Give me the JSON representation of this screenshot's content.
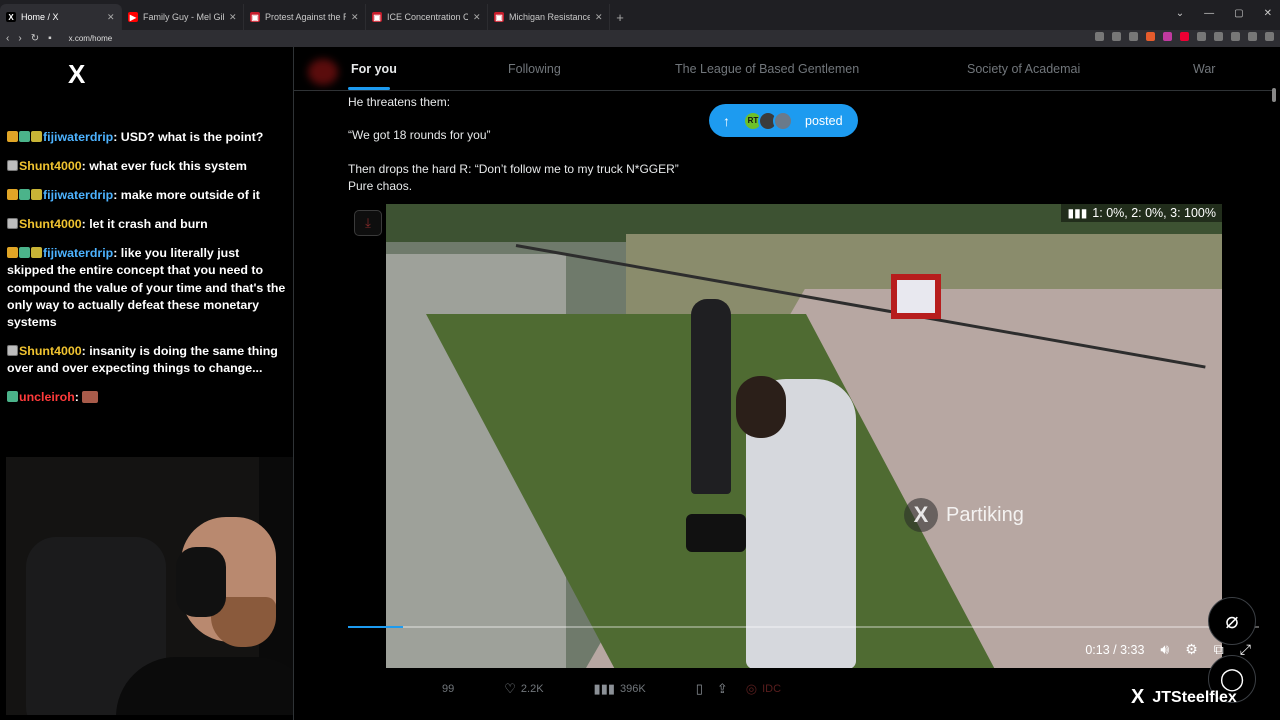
{
  "browser": {
    "tabs": [
      {
        "title": "Home / X",
        "fav": "X",
        "fav_color": "#000000",
        "active": true
      },
      {
        "title": "Family Guy - Mel Gibson Apologizes",
        "fav": "▶",
        "fav_color": "#ff0000",
        "active": false
      },
      {
        "title": "Protest Against the Regime - Royal Oak",
        "fav": "▣",
        "fav_color": "#c61c2b",
        "active": false
      },
      {
        "title": "ICE Concentration Camp Warehouse",
        "fav": "▣",
        "fav_color": "#c61c2b",
        "active": false
      },
      {
        "title": "Michigan Resistance & Activism Events",
        "fav": "▣",
        "fav_color": "#c61c2b",
        "active": false
      }
    ],
    "new_tab": "+",
    "url": "x.com/home"
  },
  "chat": {
    "logo": "X",
    "messages": [
      {
        "badges": [
          "crown",
          "green",
          "gold"
        ],
        "user": "fijiwaterdrip",
        "user_color": "blue",
        "text": ": USD? what is the point?"
      },
      {
        "badges": [
          "grey"
        ],
        "user": "Shunt4000",
        "user_color": "gold",
        "text": ": what ever fuck this system"
      },
      {
        "badges": [
          "crown",
          "green",
          "gold"
        ],
        "user": "fijiwaterdrip",
        "user_color": "blue",
        "text": ": make more outside of it"
      },
      {
        "badges": [
          "grey"
        ],
        "user": "Shunt4000",
        "user_color": "gold",
        "text": ": let it crash and burn"
      },
      {
        "badges": [
          "crown",
          "green",
          "gold"
        ],
        "user": "fijiwaterdrip",
        "user_color": "blue",
        "text": ": like you literally just skipped the entire concept that you need to compound the value of your time and that's the only way to actually defeat these monetary systems"
      },
      {
        "badges": [
          "grey"
        ],
        "user": "Shunt4000",
        "user_color": "gold",
        "text": ": insanity is doing the same thing over and over expecting things to change..."
      },
      {
        "badges": [
          "green"
        ],
        "user": "uncleiroh",
        "user_color": "red",
        "text": ": ",
        "emote": true
      }
    ]
  },
  "feed": {
    "tabs": [
      {
        "label": "For you",
        "active": true
      },
      {
        "label": "Following",
        "active": false
      },
      {
        "label": "The League of Based Gentlemen",
        "active": false
      },
      {
        "label": "Society of Academai",
        "active": false
      },
      {
        "label": "War",
        "active": false
      }
    ],
    "post": {
      "line1": "He threatens them:",
      "line2": "“We got 18 rounds for you”",
      "line3": "Then drops the hard R: “Don’t follow me to my truck N*GGER”",
      "line4": "Pure chaos."
    },
    "posted_pill": {
      "label": "posted",
      "avatar1": "RT"
    },
    "video": {
      "stats": "1: 0%, 2: 0%, 3: 100%",
      "watermark": "Partiking",
      "time": "0:13 / 3:33",
      "progress": 0.06
    },
    "actions": {
      "replies": "99",
      "likes": "2.2K",
      "views": "396K",
      "extra": "IDC"
    }
  },
  "overlay": {
    "streamer": "JTSteelflex"
  },
  "colors": {
    "accent": "#1d9bf0",
    "background": "#000000"
  }
}
